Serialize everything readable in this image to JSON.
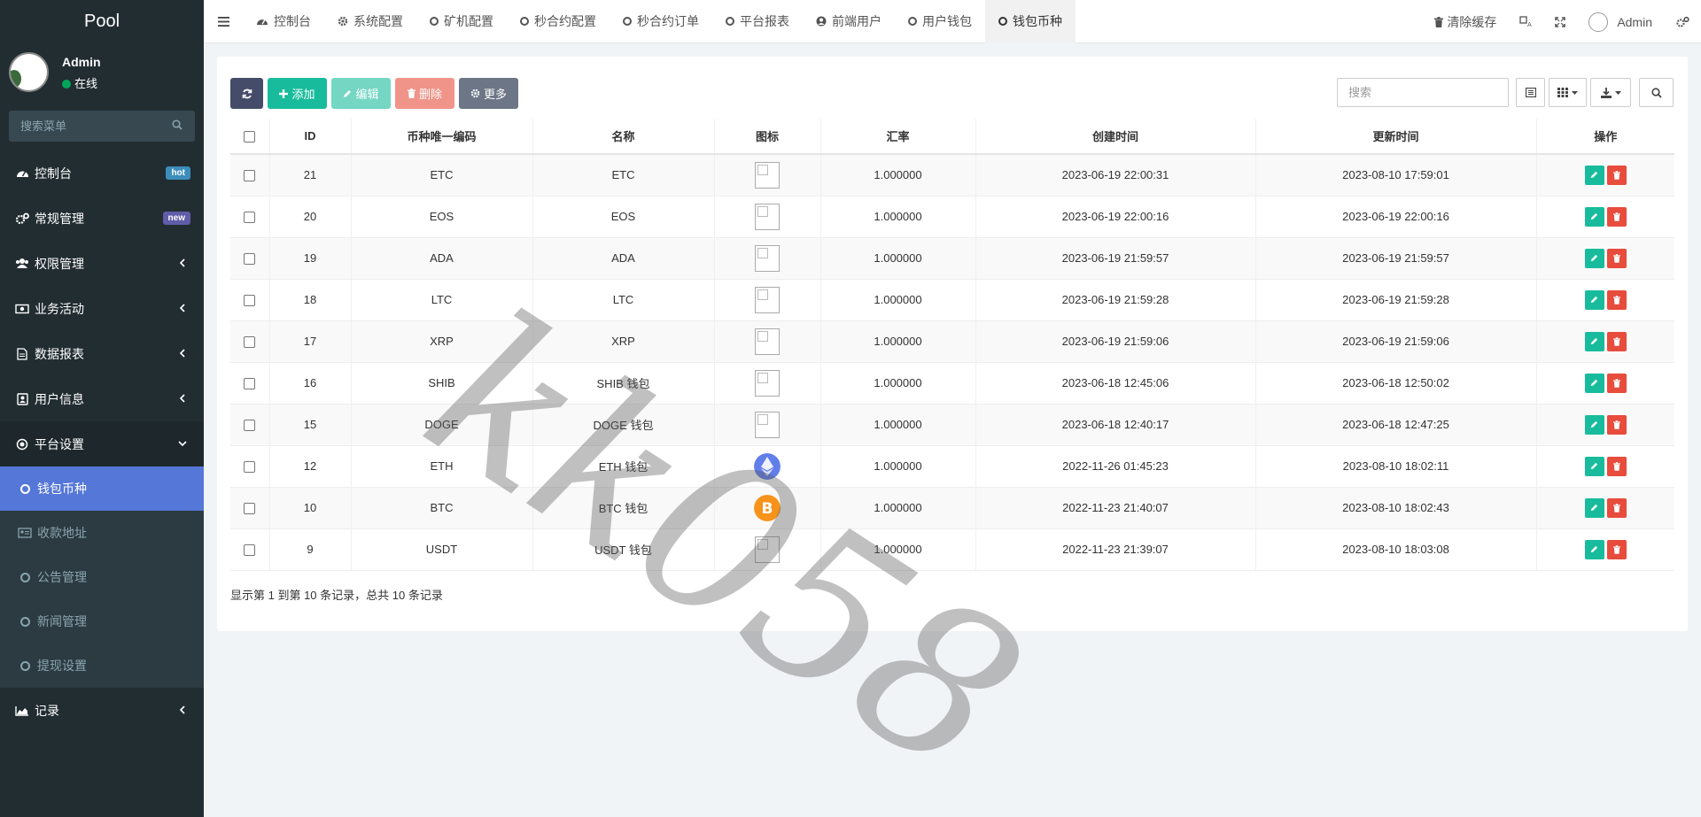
{
  "app": {
    "logo": "Pool"
  },
  "user": {
    "name": "Admin",
    "status": "在线"
  },
  "sidebar": {
    "search_placeholder": "搜索菜单",
    "items": [
      {
        "label": "控制台",
        "badge": "hot"
      },
      {
        "label": "常规管理",
        "badge": "new"
      },
      {
        "label": "权限管理"
      },
      {
        "label": "业务活动"
      },
      {
        "label": "数据报表"
      },
      {
        "label": "用户信息"
      },
      {
        "label": "平台设置"
      }
    ],
    "submenu": [
      {
        "label": "钱包币种",
        "active": true
      },
      {
        "label": "收款地址"
      },
      {
        "label": "公告管理"
      },
      {
        "label": "新闻管理"
      },
      {
        "label": "提现设置"
      }
    ],
    "last_item": {
      "label": "记录"
    }
  },
  "topnav": {
    "tabs": [
      {
        "label": "控制台",
        "icon": "dashboard-icon"
      },
      {
        "label": "系统配置",
        "icon": "gear-icon"
      },
      {
        "label": "矿机配置",
        "icon": "circle-icon"
      },
      {
        "label": "秒合约配置",
        "icon": "circle-icon"
      },
      {
        "label": "秒合约订单",
        "icon": "circle-icon"
      },
      {
        "label": "平台报表",
        "icon": "circle-icon"
      },
      {
        "label": "前端用户",
        "icon": "user-circle-icon"
      },
      {
        "label": "用户钱包",
        "icon": "circle-icon"
      },
      {
        "label": "钱包币种",
        "icon": "circle-icon",
        "active": true
      }
    ],
    "clear_cache": "清除缓存",
    "admin": "Admin"
  },
  "toolbar": {
    "add": "添加",
    "edit": "编辑",
    "delete": "删除",
    "more": "更多",
    "search_placeholder": "搜索"
  },
  "table": {
    "headers": [
      "ID",
      "币种唯一编码",
      "名称",
      "图标",
      "汇率",
      "创建时间",
      "更新时间",
      "操作"
    ],
    "rows": [
      {
        "id": "21",
        "code": "ETC",
        "name": "ETC",
        "icon": "broken-image",
        "rate": "1.000000",
        "created": "2023-06-19 22:00:31",
        "updated": "2023-08-10 17:59:01"
      },
      {
        "id": "20",
        "code": "EOS",
        "name": "EOS",
        "icon": "broken-image",
        "rate": "1.000000",
        "created": "2023-06-19 22:00:16",
        "updated": "2023-06-19 22:00:16"
      },
      {
        "id": "19",
        "code": "ADA",
        "name": "ADA",
        "icon": "broken-image",
        "rate": "1.000000",
        "created": "2023-06-19 21:59:57",
        "updated": "2023-06-19 21:59:57"
      },
      {
        "id": "18",
        "code": "LTC",
        "name": "LTC",
        "icon": "broken-image",
        "rate": "1.000000",
        "created": "2023-06-19 21:59:28",
        "updated": "2023-06-19 21:59:28"
      },
      {
        "id": "17",
        "code": "XRP",
        "name": "XRP",
        "icon": "broken-image",
        "rate": "1.000000",
        "created": "2023-06-19 21:59:06",
        "updated": "2023-06-19 21:59:06"
      },
      {
        "id": "16",
        "code": "SHIB",
        "name": "SHIB 钱包",
        "icon": "broken-image",
        "rate": "1.000000",
        "created": "2023-06-18 12:45:06",
        "updated": "2023-06-18 12:50:02"
      },
      {
        "id": "15",
        "code": "DOGE",
        "name": "DOGE 钱包",
        "icon": "broken-image",
        "rate": "1.000000",
        "created": "2023-06-18 12:40:17",
        "updated": "2023-06-18 12:47:25"
      },
      {
        "id": "12",
        "code": "ETH",
        "name": "ETH 钱包",
        "icon": "eth-coin-icon",
        "rate": "1.000000",
        "created": "2022-11-26 01:45:23",
        "updated": "2023-08-10 18:02:11"
      },
      {
        "id": "10",
        "code": "BTC",
        "name": "BTC 钱包",
        "icon": "btc-coin-icon",
        "rate": "1.000000",
        "created": "2022-11-23 21:40:07",
        "updated": "2023-08-10 18:02:43"
      },
      {
        "id": "9",
        "code": "USDT",
        "name": "USDT 钱包",
        "icon": "broken-image",
        "rate": "1.000000",
        "created": "2022-11-23 21:39:07",
        "updated": "2023-08-10 18:03:08"
      }
    ]
  },
  "footer": {
    "summary": "显示第 1 到第 10 条记录，总共 10 条记录"
  },
  "watermark": "kk058",
  "colors": {
    "sidebar_bg": "#222d32",
    "active_menu": "#5577d8",
    "success": "#18bc9c",
    "danger": "#e74c3c",
    "primary_dark": "#444c69"
  }
}
